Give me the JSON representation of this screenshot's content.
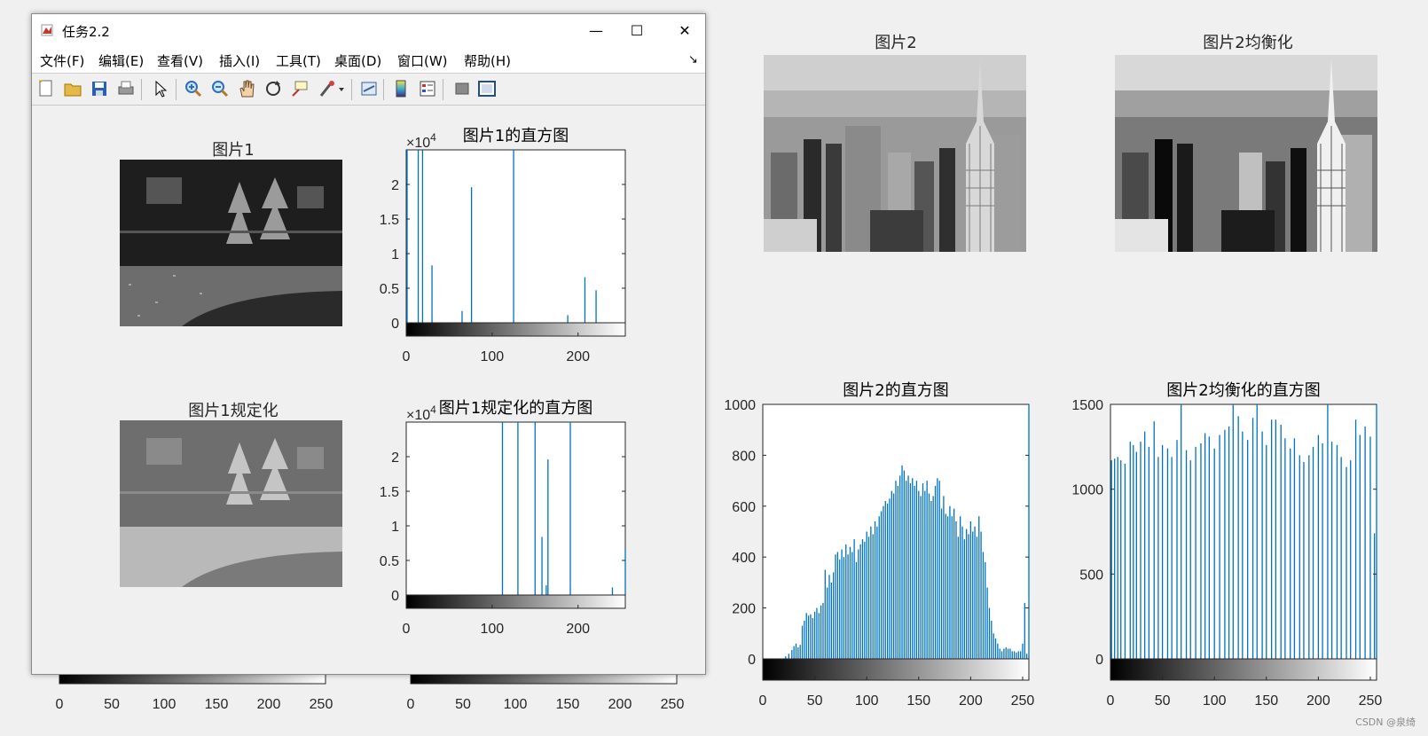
{
  "window": {
    "title": "任务2.2",
    "minimize_glyph": "—",
    "maximize_glyph": "☐",
    "close_glyph": "✕",
    "menu": [
      "文件(F)",
      "编辑(E)",
      "查看(V)",
      "插入(I)",
      "工具(T)",
      "桌面(D)",
      "窗口(W)",
      "帮助(H)"
    ],
    "dock_glyph": "↘",
    "toolbar_icons": [
      "new-figure-icon",
      "open-file-icon",
      "save-icon",
      "print-icon",
      "select-arrow-icon",
      "zoom-in-icon",
      "zoom-out-icon",
      "pan-hand-icon",
      "rotate-3d-icon",
      "data-cursor-icon",
      "brush-icon",
      "brush-dropdown-icon",
      "link-plot-icon",
      "colorbar-icon",
      "legend-icon",
      "hide-plot-tools-icon",
      "show-plot-tools-icon"
    ]
  },
  "images": {
    "img1_title": "图片1",
    "img1_spec_title": "图片1规定化",
    "img2_title": "图片2",
    "img2_eq_title": "图片2均衡化"
  },
  "watermark": "CSDN @泉绮",
  "chart_data": [
    {
      "id": "hist1",
      "type": "bar",
      "title": "图片1的直方图",
      "xlim": [
        0,
        255
      ],
      "ylim": [
        0,
        25000
      ],
      "xticks": [
        0,
        100,
        200
      ],
      "yticks": [
        0,
        5000,
        10000,
        15000,
        20000
      ],
      "ytick_labels": [
        "0",
        "0.5",
        "1",
        "1.5",
        "2"
      ],
      "exponent_label": "×10",
      "exponent_power": "4",
      "colorbar": "gray",
      "x": [
        1,
        14,
        19,
        30,
        65,
        76,
        125,
        188,
        208,
        221
      ],
      "values": [
        25000,
        25000,
        25000,
        8300,
        1700,
        19600,
        25000,
        1100,
        6600,
        4700
      ]
    },
    {
      "id": "hist1spec",
      "type": "bar",
      "title": "图片1规定化的直方图",
      "xlim": [
        0,
        255
      ],
      "ylim": [
        0,
        25000
      ],
      "xticks": [
        0,
        100,
        200
      ],
      "yticks": [
        0,
        5000,
        10000,
        15000,
        20000
      ],
      "ytick_labels": [
        "0",
        "0.5",
        "1",
        "1.5",
        "2"
      ],
      "exponent_label": "×10",
      "exponent_power": "4",
      "colorbar": "gray",
      "x": [
        112,
        130,
        150,
        158,
        163,
        165,
        191,
        240,
        255
      ],
      "values": [
        25000,
        25000,
        25000,
        8400,
        1400,
        19600,
        25000,
        1100,
        6500
      ]
    },
    {
      "id": "hist2",
      "type": "bar",
      "title": "图片2的直方图",
      "xlim": [
        0,
        256
      ],
      "ylim": [
        0,
        1000
      ],
      "xticks": [
        0,
        50,
        100,
        150,
        200,
        250
      ],
      "yticks": [
        0,
        200,
        400,
        600,
        800,
        1000
      ],
      "colorbar": "gray",
      "x": [
        22,
        25,
        28,
        30,
        32,
        34,
        36,
        38,
        40,
        42,
        44,
        46,
        48,
        50,
        52,
        54,
        56,
        58,
        60,
        62,
        64,
        66,
        68,
        70,
        72,
        74,
        76,
        78,
        80,
        82,
        84,
        86,
        88,
        90,
        92,
        94,
        96,
        98,
        100,
        102,
        104,
        106,
        108,
        110,
        112,
        114,
        116,
        118,
        120,
        122,
        124,
        126,
        128,
        130,
        132,
        134,
        136,
        138,
        140,
        142,
        144,
        146,
        148,
        150,
        152,
        154,
        156,
        158,
        160,
        162,
        164,
        166,
        168,
        170,
        172,
        174,
        176,
        178,
        180,
        182,
        184,
        186,
        188,
        190,
        192,
        194,
        196,
        198,
        200,
        202,
        204,
        206,
        208,
        210,
        212,
        214,
        216,
        218,
        220,
        222,
        224,
        226,
        228,
        230,
        232,
        234,
        236,
        238,
        240,
        242,
        244,
        246,
        248,
        250,
        252,
        254,
        256
      ],
      "values": [
        10,
        20,
        35,
        50,
        60,
        45,
        55,
        130,
        150,
        180,
        170,
        175,
        160,
        185,
        200,
        180,
        210,
        220,
        350,
        280,
        330,
        300,
        340,
        410,
        420,
        390,
        430,
        400,
        450,
        410,
        440,
        420,
        470,
        380,
        430,
        450,
        470,
        460,
        500,
        480,
        520,
        490,
        540,
        520,
        560,
        580,
        600,
        620,
        610,
        630,
        660,
        650,
        700,
        680,
        720,
        760,
        740,
        700,
        720,
        690,
        710,
        680,
        700,
        660,
        640,
        690,
        660,
        700,
        650,
        620,
        640,
        680,
        710,
        700,
        590,
        640,
        570,
        560,
        600,
        560,
        590,
        540,
        480,
        560,
        520,
        470,
        510,
        490,
        540,
        500,
        520,
        480,
        560,
        500,
        420,
        380,
        280,
        200,
        150,
        100,
        80,
        60,
        40,
        30,
        40,
        45,
        40,
        40,
        30,
        30,
        25,
        30,
        30,
        60,
        220,
        20,
        1000
      ]
    },
    {
      "id": "hist2eq",
      "type": "bar",
      "title": "图片2均衡化的直方图",
      "xlim": [
        0,
        256
      ],
      "ylim": [
        0,
        1500
      ],
      "xticks": [
        0,
        50,
        100,
        150,
        200,
        250
      ],
      "yticks": [
        0,
        500,
        1000,
        1500
      ],
      "colorbar": "gray",
      "x": [
        1,
        4,
        7,
        10,
        14,
        19,
        22,
        25,
        29,
        33,
        37,
        42,
        46,
        50,
        55,
        59,
        64,
        68,
        73,
        77,
        82,
        87,
        91,
        95,
        100,
        105,
        110,
        114,
        118,
        123,
        127,
        132,
        137,
        141,
        146,
        150,
        155,
        159,
        164,
        168,
        173,
        177,
        182,
        186,
        191,
        195,
        200,
        204,
        209,
        213,
        218,
        222,
        227,
        231,
        236,
        240,
        245,
        250,
        254,
        256
      ],
      "values": [
        1170,
        1180,
        1190,
        1170,
        1150,
        1280,
        1260,
        1220,
        1280,
        1340,
        1250,
        1400,
        1190,
        1260,
        1240,
        1190,
        1290,
        1500,
        1230,
        1170,
        1250,
        1270,
        1330,
        1310,
        1240,
        1320,
        1350,
        1370,
        1500,
        1430,
        1340,
        1290,
        1420,
        1500,
        1340,
        1260,
        1410,
        1410,
        1380,
        1300,
        1240,
        1300,
        1200,
        1160,
        1200,
        1250,
        1320,
        1270,
        1500,
        1280,
        1260,
        1190,
        1130,
        1170,
        1410,
        1320,
        1370,
        1310,
        740,
        1500
      ]
    }
  ]
}
